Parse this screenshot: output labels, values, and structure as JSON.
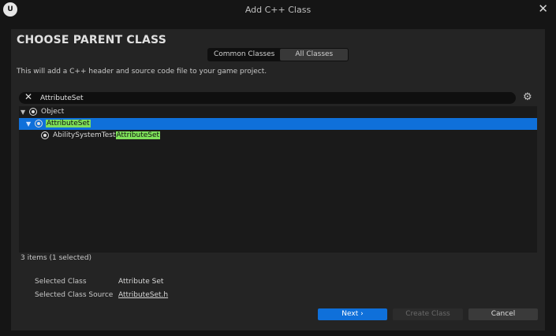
{
  "window": {
    "title": "Add C++ Class",
    "logo_text": "U"
  },
  "header": {
    "title": "CHOOSE PARENT CLASS"
  },
  "tabs": [
    {
      "label": "Common Classes",
      "active": false
    },
    {
      "label": "All Classes",
      "active": true
    }
  ],
  "description": "This will add a C++ header and source code file to your game project.",
  "search": {
    "value": "AttributeSet",
    "placeholder": ""
  },
  "tree": {
    "root": {
      "label": "Object"
    },
    "selected": {
      "label": "AttributeSet"
    },
    "child": {
      "prefix": "AbilitySystemTest",
      "match": "AttributeSet"
    }
  },
  "status": {
    "count_text": "3 items (1 selected)"
  },
  "info": {
    "selected_class_label": "Selected Class",
    "selected_class_value": "Attribute Set",
    "source_label": "Selected Class Source",
    "source_value": "AttributeSet.h"
  },
  "buttons": {
    "next": "Next",
    "create": "Create Class",
    "cancel": "Cancel"
  },
  "colors": {
    "accent": "#0f70da",
    "highlight": "#7ee05a",
    "background": "#151515",
    "panel": "#242424"
  }
}
